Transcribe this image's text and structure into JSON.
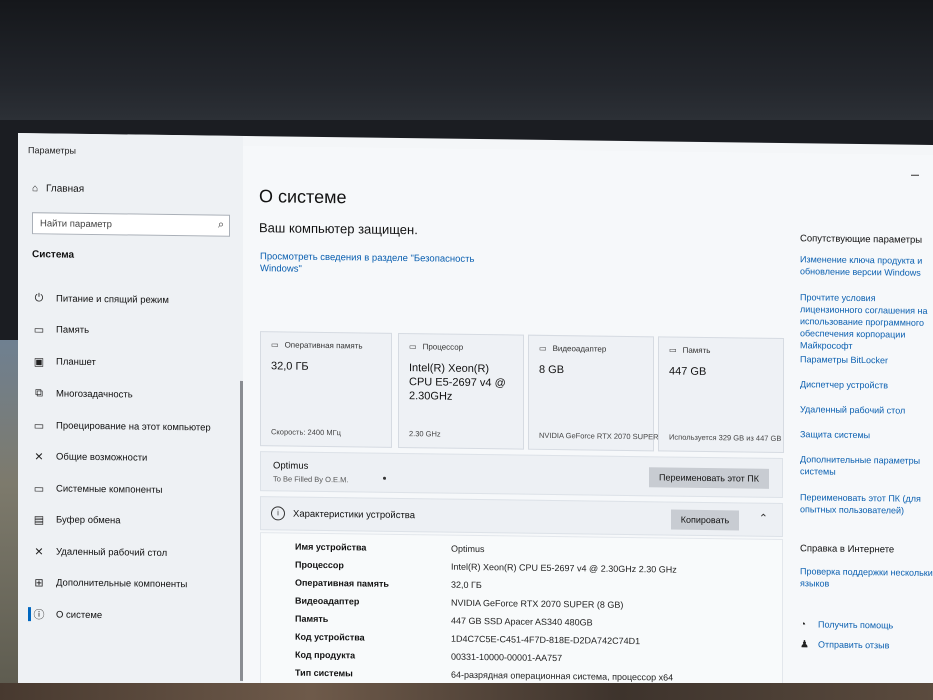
{
  "window": {
    "title": "Параметры"
  },
  "sidebar": {
    "home_label": "Главная",
    "search_placeholder": "Найти параметр",
    "section_label": "Система",
    "items": [
      {
        "label": "Питание и спящий режим",
        "icon": "power-icon"
      },
      {
        "label": "Память",
        "icon": "storage-icon"
      },
      {
        "label": "Планшет",
        "icon": "tablet-icon"
      },
      {
        "label": "Многозадачность",
        "icon": "multitasking-icon"
      },
      {
        "label": "Проецирование на этот компьютер",
        "icon": "projecting-icon"
      },
      {
        "label": "Общие возможности",
        "icon": "shared-icon"
      },
      {
        "label": "Системные компоненты",
        "icon": "components-icon"
      },
      {
        "label": "Буфер обмена",
        "icon": "clipboard-icon"
      },
      {
        "label": "Удаленный рабочий стол",
        "icon": "remote-desktop-icon"
      },
      {
        "label": "Дополнительные компоненты",
        "icon": "optional-features-icon"
      },
      {
        "label": "О системе",
        "icon": "info-icon",
        "selected": true
      }
    ]
  },
  "main": {
    "title": "О системе",
    "protected": "Ваш компьютер защищен.",
    "security_link": "Просмотреть сведения в разделе \"Безопасность Windows\"",
    "cards": [
      {
        "label": "Оперативная память",
        "value": "32,0 ГБ",
        "sub": "Скорость: 2400 МГц"
      },
      {
        "label": "Процессор",
        "value": "Intel(R) Xeon(R) CPU E5-2697 v4 @ 2.30GHz",
        "sub": "2.30 GHz"
      },
      {
        "label": "Видеоадаптер",
        "value": "8 GB",
        "sub": "NVIDIA GeForce RTX 2070 SUPER"
      },
      {
        "label": "Память",
        "value": "447 GB",
        "sub": "Используется 329 GB из 447 GB"
      }
    ],
    "pc_name": "Optimus",
    "pc_sub": "To Be Filled By O.E.M.",
    "rename_button": "Переименовать этот ПК",
    "device_spec_title": "Характеристики устройства",
    "copy_button": "Копировать",
    "specs": [
      {
        "k": "Имя устройства",
        "v": "Optimus"
      },
      {
        "k": "Процессор",
        "v": "Intel(R) Xeon(R) CPU E5-2697 v4 @ 2.30GHz   2.30 GHz"
      },
      {
        "k": "Оперативная память",
        "v": "32,0 ГБ"
      },
      {
        "k": "Видеоадаптер",
        "v": "NVIDIA GeForce RTX 2070 SUPER (8 GB)"
      },
      {
        "k": "Память",
        "v": "447 GB SSD Apacer AS340 480GB"
      },
      {
        "k": "Код устройства",
        "v": "1D4C7C5E-C451-4F7D-818E-D2DA742C74D1"
      },
      {
        "k": "Код продукта",
        "v": "00331-10000-00001-AA757"
      },
      {
        "k": "Тип системы",
        "v": "64-разрядная операционная система, процессор x64"
      }
    ]
  },
  "related": {
    "title": "Сопутствующие параметры",
    "links": [
      "Изменение ключа продукта и обновление версии Windows",
      "Прочтите условия лицензионного соглашения на использование программного обеспечения корпорации Майкрософт",
      "Параметры BitLocker",
      "Диспетчер устройств",
      "Удаленный рабочий стол",
      "Защита системы",
      "Дополнительные параметры системы",
      "Переименовать этот ПК (для опытных пользователей)"
    ],
    "web_help_title": "Справка в Интернете",
    "web_help_link": "Проверка поддержки нескольких языков",
    "get_help": "Получить помощь",
    "feedback": "Отправить отзыв"
  }
}
